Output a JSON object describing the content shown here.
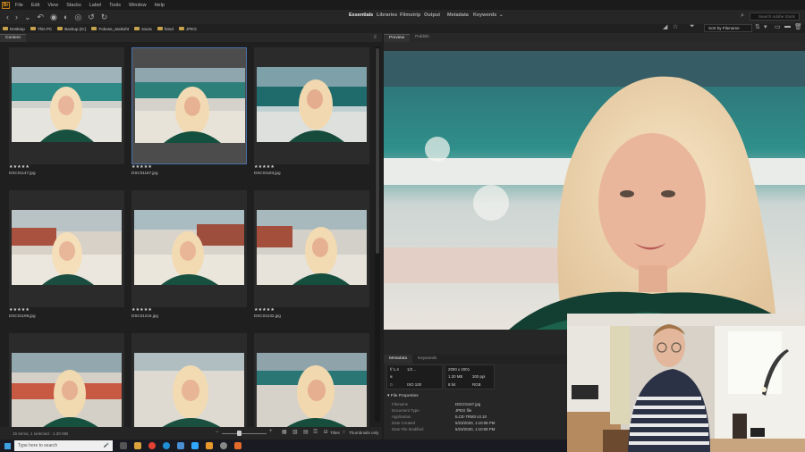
{
  "menu": [
    "File",
    "Edit",
    "View",
    "Stacks",
    "Label",
    "Tools",
    "Window",
    "Help"
  ],
  "app_logo": "Br",
  "workspaces": [
    "Essentials",
    "Libraries",
    "Filmstrip",
    "Output",
    "Metadata",
    "Keywords"
  ],
  "active_workspace": "Essentials",
  "search_placeholder": "Search Adobe Stock",
  "path": [
    "Desktop",
    "This PC",
    "Backup (D:)",
    "Fokose_asokoht",
    "soura",
    "fotod",
    "JPEG"
  ],
  "sort_label": "Sort by Filename",
  "left_tabs": [
    "Content"
  ],
  "right_tabs": [
    "Preview",
    "Publish"
  ],
  "rating_stars": "★★★★★",
  "thumbnails": [
    {
      "file": "DSC01147.jpg"
    },
    {
      "file": "DSC01167.jpg"
    },
    {
      "file": "DSC01183.jpg"
    },
    {
      "file": "DSC01199.jpg"
    },
    {
      "file": "DSC01216.jpg"
    },
    {
      "file": "DSC01232.jpg"
    },
    {
      "file": ""
    },
    {
      "file": ""
    },
    {
      "file": ""
    }
  ],
  "status_text": "15 items, 1 selected - 1.30 MB",
  "view_toggle": {
    "titles": "Titles",
    "thumbnails_only": "Thumbnails only"
  },
  "metadata_tabs": [
    "Metadata",
    "Keywords"
  ],
  "camera": {
    "fstop": "f/ 1.4",
    "shutter": "1/2…",
    "iso": "ISO 100",
    "dims": "2000 x 2001",
    "size": "1.30 MB",
    "dpi": "300 ppi",
    "bits": "8 bit",
    "color": "RGB"
  },
  "file_properties_header": "File Properties",
  "file_properties": [
    {
      "k": "Filename",
      "v": "DSC01167.jpg"
    },
    {
      "k": "Document Type",
      "v": "JPEG file"
    },
    {
      "k": "Application",
      "v": "ILCE-7RM3 v3.10"
    },
    {
      "k": "Date Created",
      "v": "5/23/2020, 1:10:08 PM"
    },
    {
      "k": "Date File Modified",
      "v": "5/23/2020, 1:10:08 PM"
    }
  ],
  "taskbar_search_placeholder": "Type here to search"
}
